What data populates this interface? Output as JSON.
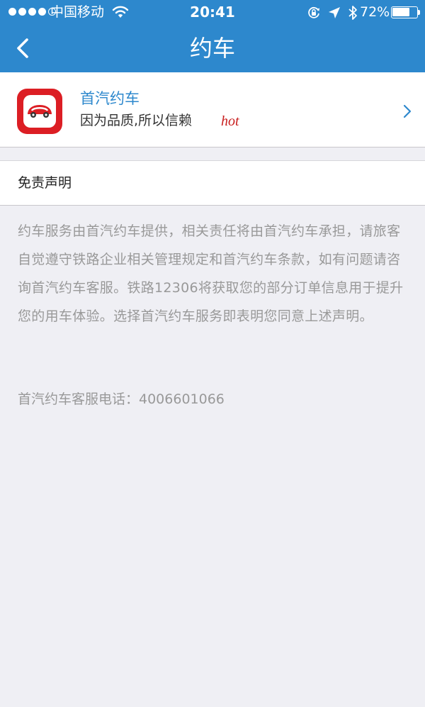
{
  "status_bar": {
    "carrier": "中国移动",
    "time": "20:41",
    "battery_percent": "72%",
    "battery_level": 0.72,
    "signal_bars_filled": 4,
    "signal_bars_total": 5
  },
  "nav": {
    "title": "约车"
  },
  "service": {
    "name": "首汽约车",
    "tagline": "因为品质,所以信赖",
    "badge": "hot"
  },
  "disclaimer": {
    "title": "免责声明",
    "body": "约车服务由首汽约车提供，相关责任将由首汽约车承担，请旅客自觉遵守铁路企业相关管理规定和首汽约车条款，如有问题请咨询首汽约车客服。铁路12306将获取您的部分订单信息用于提升您的用车体验。选择首汽约车服务即表明您同意上述声明。",
    "phone_line": "首汽约车客服电话：4006601066"
  },
  "colors": {
    "header_bg": "#2d88cd",
    "accent": "#2d88cd",
    "hot": "#c81e1e",
    "app_icon_red": "#dc1e24",
    "page_bg": "#efeff4"
  }
}
